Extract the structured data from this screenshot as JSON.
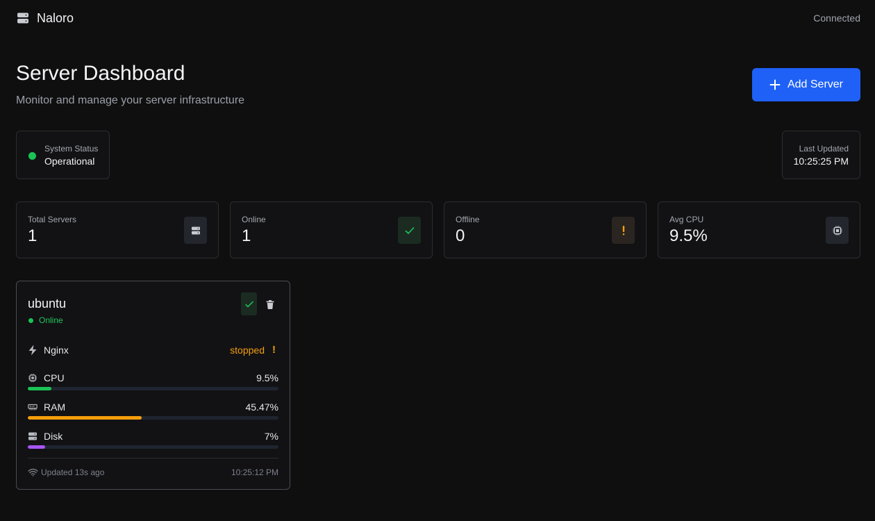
{
  "header": {
    "app_name": "Naloro",
    "connection_status": "Connected"
  },
  "page": {
    "title": "Server Dashboard",
    "subtitle": "Monitor and manage your server infrastructure",
    "add_button_label": "Add Server"
  },
  "system_status": {
    "label": "System Status",
    "value": "Operational",
    "color": "#19c455"
  },
  "last_updated": {
    "label": "Last Updated",
    "value": "10:25:25 PM"
  },
  "stats": [
    {
      "label": "Total Servers",
      "value": "1",
      "icon": "server-icon"
    },
    {
      "label": "Online",
      "value": "1",
      "icon": "check-icon"
    },
    {
      "label": "Offline",
      "value": "0",
      "icon": "alert-icon"
    },
    {
      "label": "Avg CPU",
      "value": "9.5%",
      "icon": "cpu-icon"
    }
  ],
  "servers": [
    {
      "name": "ubuntu",
      "status": "Online",
      "service": {
        "name": "Nginx",
        "status": "stopped",
        "status_mark": "!"
      },
      "metrics": [
        {
          "name": "CPU",
          "value_text": "9.5%",
          "percent": 9.5,
          "color": "#19c455",
          "icon": "cpu-icon"
        },
        {
          "name": "RAM",
          "value_text": "45.47%",
          "percent": 45.47,
          "color": "#f59e0b",
          "icon": "memory-icon"
        },
        {
          "name": "Disk",
          "value_text": "7%",
          "percent": 7,
          "color": "#a855f7",
          "icon": "disk-icon"
        }
      ],
      "updated_ago": "Updated 13s ago",
      "updated_time": "10:25:12 PM"
    }
  ],
  "colors": {
    "accent": "#1f61f6",
    "online": "#22c55e",
    "warning": "#f59e0b"
  }
}
